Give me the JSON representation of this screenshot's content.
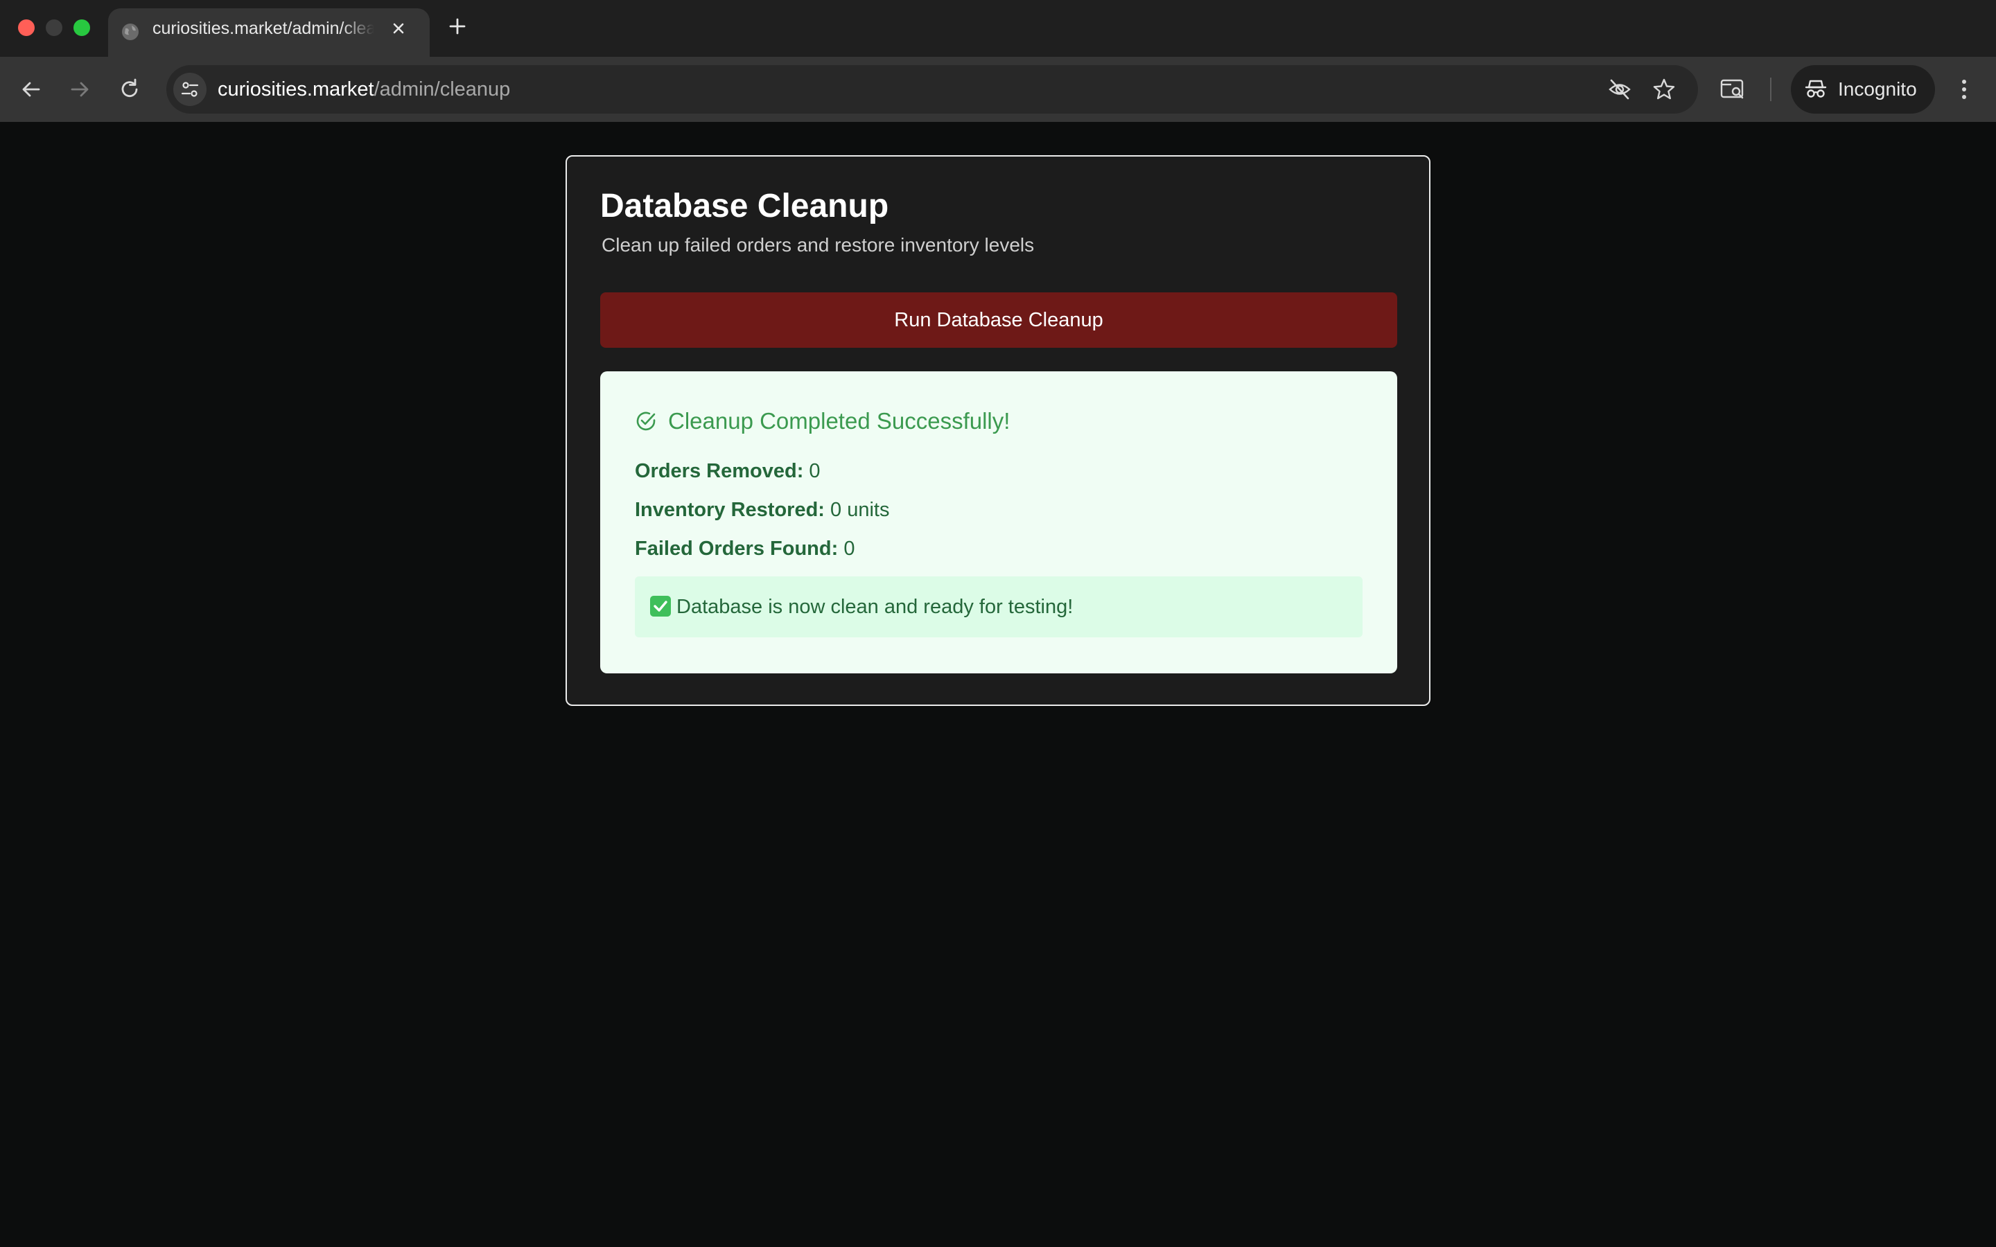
{
  "browser": {
    "tab_title": "curiosities.market/admin/cleanup",
    "url_host": "curiosities.market",
    "url_path": "/admin/cleanup",
    "profile_label": "Incognito"
  },
  "page": {
    "title": "Database Cleanup",
    "subtitle": "Clean up failed orders and restore inventory levels",
    "run_button_label": "Run Database Cleanup",
    "result": {
      "heading": "Cleanup Completed Successfully!",
      "stats": [
        {
          "label": "Orders Removed:",
          "value": "0"
        },
        {
          "label": "Inventory Restored:",
          "value": "0 units"
        },
        {
          "label": "Failed Orders Found:",
          "value": "0"
        }
      ],
      "notice": "Database is now clean and ready for testing!"
    }
  },
  "colors": {
    "danger_button": "#6e1917",
    "success_bg": "#f0fdf4",
    "success_text": "#24673a",
    "success_heading": "#3b9a4f"
  },
  "icons": [
    "globe-icon",
    "close-icon",
    "plus-icon",
    "back-arrow-icon",
    "forward-arrow-icon",
    "reload-icon",
    "site-settings-icon",
    "eye-off-icon",
    "star-icon",
    "tab-search-icon",
    "incognito-icon",
    "more-vert-icon",
    "check-circle-icon",
    "checkmark-emoji-icon"
  ]
}
